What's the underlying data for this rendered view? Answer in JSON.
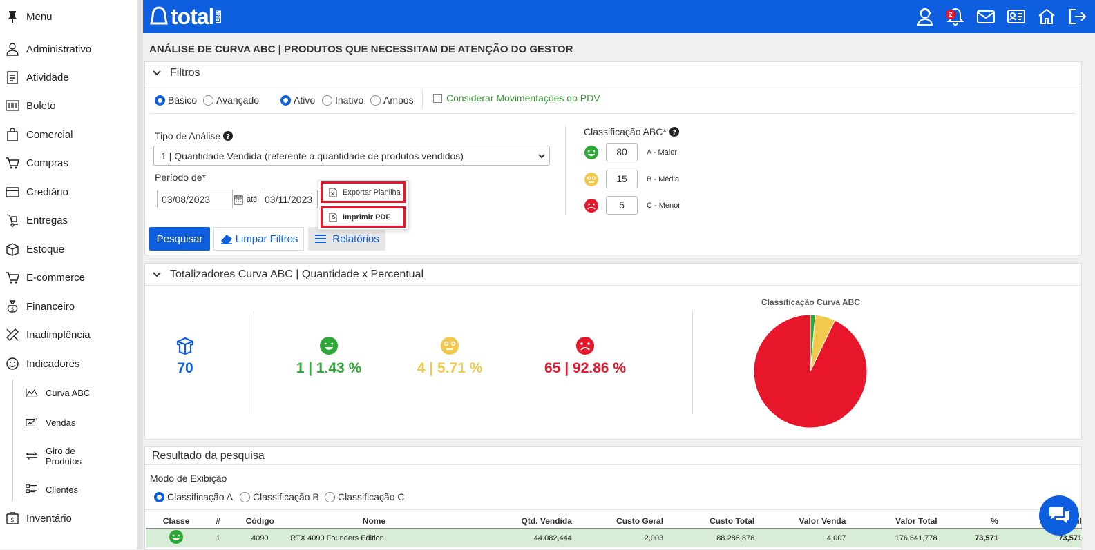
{
  "sidebar": {
    "menu_label": "Menu",
    "items": [
      {
        "label": "Administrativo",
        "icon": "user-tie-icon"
      },
      {
        "label": "Atividade",
        "icon": "checklist-icon"
      },
      {
        "label": "Boleto",
        "icon": "barcode-icon"
      },
      {
        "label": "Comercial",
        "icon": "shopping-bag-icon"
      },
      {
        "label": "Compras",
        "icon": "cart-icon"
      },
      {
        "label": "Crediário",
        "icon": "credit-card-icon"
      },
      {
        "label": "Entregas",
        "icon": "hand-truck-icon"
      },
      {
        "label": "Estoque",
        "icon": "box-icon"
      },
      {
        "label": "E-commerce",
        "icon": "cart-icon"
      },
      {
        "label": "Financeiro",
        "icon": "money-bag-icon"
      },
      {
        "label": "Inadimplência",
        "icon": "ruler-pencil-icon"
      },
      {
        "label": "Indicadores",
        "icon": "smile-icon"
      }
    ],
    "sub_items": [
      {
        "label": "Curva ABC",
        "icon": "area-chart-icon"
      },
      {
        "label": "Vendas",
        "icon": "sales-chart-icon"
      },
      {
        "label": "Giro de Produtos",
        "icon": "arrows-icon"
      },
      {
        "label": "Clientes",
        "icon": "client-list-icon"
      }
    ],
    "last_item": {
      "label": "Inventário",
      "icon": "money-box-icon"
    }
  },
  "topbar": {
    "logo_text": "total",
    "logo_sub": "ERP",
    "notifications_count": "2"
  },
  "page_title": "ANÁLISE DE CURVA ABC | PRODUTOS QUE NECESSITAM DE ATENÇÃO DO GESTOR",
  "filters": {
    "title": "Filtros",
    "mode_options": [
      "Básico",
      "Avançado"
    ],
    "status_options": [
      "Ativo",
      "Inativo",
      "Ambos"
    ],
    "pdv_checkbox": "Considerar Movimentações do PDV",
    "analysis_type_label": "Tipo de Análise",
    "analysis_type_value": "1 | Quantidade Vendida (referente a quantidade de produtos vendidos)",
    "period_label": "Período de*",
    "date_from": "03/08/2023",
    "date_sep": "até",
    "date_to": "03/11/2023",
    "abc_label": "Classificação ABC*",
    "abc": [
      {
        "value": "80",
        "label": "A - Maior",
        "color": "#2ea836"
      },
      {
        "value": "15",
        "label": "B - Média",
        "color": "#f2c94c"
      },
      {
        "value": "5",
        "label": "C - Menor",
        "color": "#e8162a"
      }
    ],
    "buttons": {
      "search": "Pesquisar",
      "clear": "Limpar Filtros",
      "reports": "Relatórios"
    },
    "dropdown": {
      "export": "Exportar Planilha",
      "print": "Imprimir PDF"
    }
  },
  "totals": {
    "title": "Totalizadores Curva ABC | Quantidade x Percentual",
    "total": "70",
    "a": "1 | 1.43 %",
    "b": "4 | 5.71 %",
    "c": "65 | 92.86 %",
    "colors": {
      "total": "#0d5fe0",
      "a": "#2ea836",
      "b": "#f2c94c",
      "c": "#e8162a"
    }
  },
  "chart_data": {
    "type": "pie",
    "title": "Classificação Curva ABC",
    "categories": [
      "A",
      "B",
      "C"
    ],
    "values": [
      1.43,
      5.71,
      92.86
    ],
    "colors": [
      "#2ea836",
      "#f2c94c",
      "#e8162a"
    ]
  },
  "results": {
    "title": "Resultado da pesquisa",
    "display_mode_label": "Modo de Exibição",
    "display_options": [
      "Classificação A",
      "Classificação B",
      "Classificação C"
    ],
    "columns": [
      "Classe",
      "#",
      "Código",
      "Nome",
      "Qtd. Vendida",
      "Custo Geral",
      "Custo Total",
      "Valor Venda",
      "Valor Total",
      "%",
      "% Acumul"
    ],
    "rows": [
      [
        "",
        "1",
        "4090",
        "RTX 4090 Founders Edition",
        "44.082,444",
        "2,003",
        "88.288,878",
        "4,007",
        "176.641,778",
        "73,571",
        "73,571"
      ]
    ]
  }
}
